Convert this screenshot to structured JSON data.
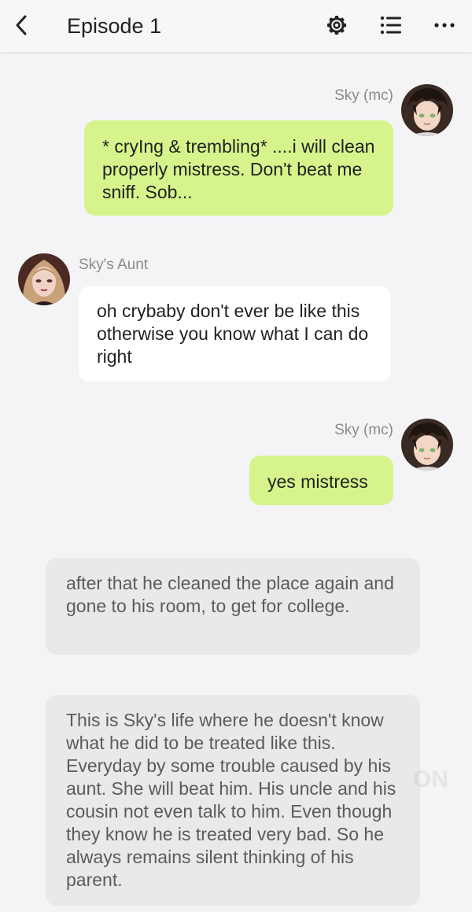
{
  "header": {
    "title": "Episode 1",
    "icons": [
      "back-icon",
      "gear-icon",
      "list-icon",
      "more-icon"
    ]
  },
  "messages": [
    {
      "type": "me",
      "name": "Sky (mc)",
      "avatar": "sky-avatar",
      "text": "* cryIng & trembling* ....i will clean properly mistress. Don't beat me sniff. Sob..."
    },
    {
      "type": "them",
      "name": "Sky's Aunt",
      "avatar": "aunt-avatar",
      "text": "oh crybaby don't ever be like this otherwise you know what I can do right"
    },
    {
      "type": "me",
      "name": "Sky (mc)",
      "avatar": "sky-avatar",
      "text": "yes mistress"
    },
    {
      "type": "narration",
      "text": "after that he cleaned  the place again and gone to his room, to get for college."
    },
    {
      "type": "narration",
      "text": "This is Sky's life where he doesn't know what he did to be treated like this. Everyday by some trouble caused by his aunt. She will beat him. His uncle and his cousin not even talk to him. Even though they know he is treated very bad. So he always remains silent thinking of his parent."
    }
  ],
  "colors": {
    "background": "#f4f4f6",
    "my_bubble": "#d6f48b",
    "their_bubble": "#ffffff",
    "narration_bubble": "#e9e9eb"
  }
}
